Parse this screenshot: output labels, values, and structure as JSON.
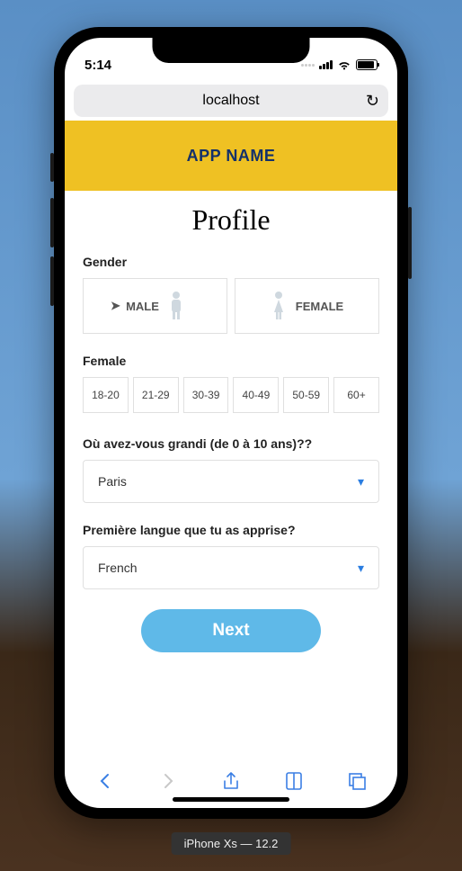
{
  "status": {
    "time": "5:14"
  },
  "browser": {
    "address": "localhost"
  },
  "header": {
    "app_name": "APP NAME"
  },
  "page": {
    "title": "Profile"
  },
  "gender": {
    "label": "Gender",
    "male": "MALE",
    "female": "FEMALE"
  },
  "age": {
    "label": "Female",
    "ranges": [
      "18-20",
      "21-29",
      "30-39",
      "40-49",
      "50-59",
      "60+"
    ]
  },
  "origin": {
    "label": "Où avez-vous grandi (de 0 à 10 ans)??",
    "value": "Paris"
  },
  "language": {
    "label": "Première langue que tu as apprise?",
    "value": "French"
  },
  "next_label": "Next",
  "device_label": "iPhone Xs — 12.2"
}
